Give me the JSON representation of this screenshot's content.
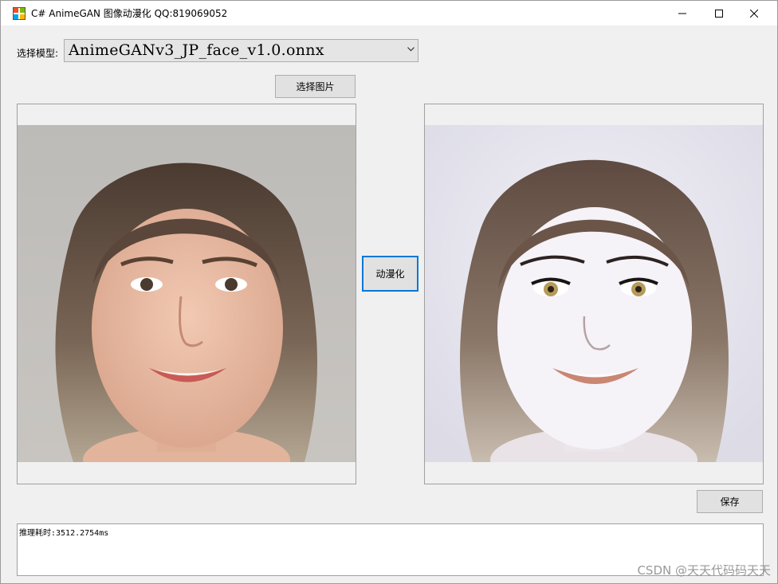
{
  "window": {
    "title": "C# AnimeGAN 图像动漫化 QQ:819069052",
    "controls": {
      "minimize": "minimize-icon",
      "maximize": "maximize-icon",
      "close": "close-icon"
    }
  },
  "model": {
    "label": "选择模型:",
    "selected": "AnimeGANv3_JP_face_v1.0.onnx"
  },
  "buttons": {
    "choose_image": "选择图片",
    "animate": "动漫化",
    "save": "保存"
  },
  "images": {
    "input": "photo of a woman (original)",
    "output": "anime-style stylized portrait"
  },
  "log": {
    "text": "推理耗时:3512.2754ms"
  },
  "watermark": "CSDN @天天代码码天天",
  "colors": {
    "focus_border": "#0078d7",
    "window_bg": "#f0f0f0"
  }
}
